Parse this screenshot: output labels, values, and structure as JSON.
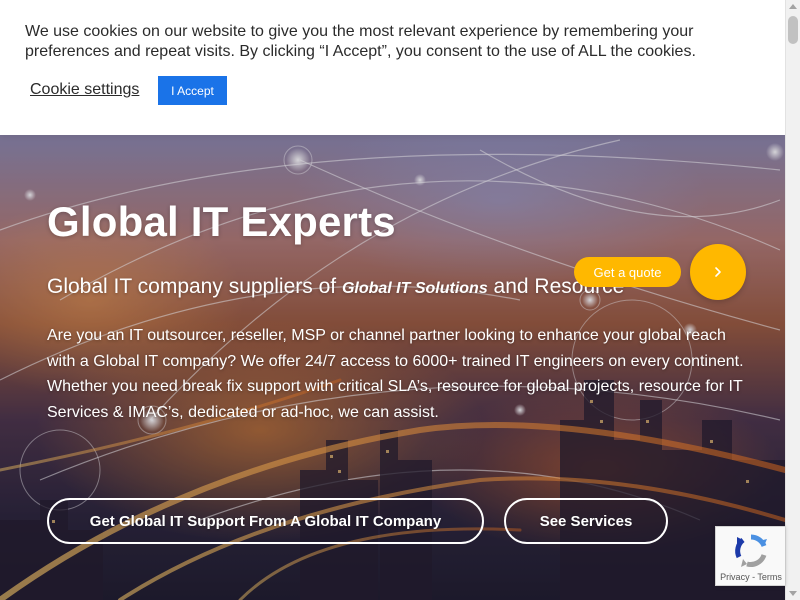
{
  "cookie": {
    "message": "We use cookies on our website to give you the most relevant experience by remembering your preferences and repeat visits. By clicking “I Accept”, you consent to the use of ALL the cookies.",
    "settings_label": "Cookie settings",
    "accept_label": "I Accept",
    "accept_color": "#1a73e8"
  },
  "hero": {
    "title": "Global IT Experts",
    "subtitle_before": "Global IT company suppliers of ",
    "subtitle_emphasis": "Global IT Solutions",
    "subtitle_after": " and Resource",
    "body": "Are you an IT outsourcer, reseller, MSP or channel partner looking to enhance your global reach with a Global IT company? We offer 24/7 access to 6000+ trained IT engineers on every continent. Whether you need break fix support with critical SLA’s, resource for global projects, resource for IT Services & IMAC’s, dedicated or ad-hoc, we can assist.",
    "primary_button": "Get Global IT Support From A Global IT Company",
    "secondary_button": "See Services"
  },
  "quote": {
    "label": "Get a quote",
    "icon": "chevron-right-icon",
    "color": "#ffb800"
  },
  "recaptcha": {
    "privacy": "Privacy",
    "separator": " - ",
    "terms": "Terms"
  }
}
